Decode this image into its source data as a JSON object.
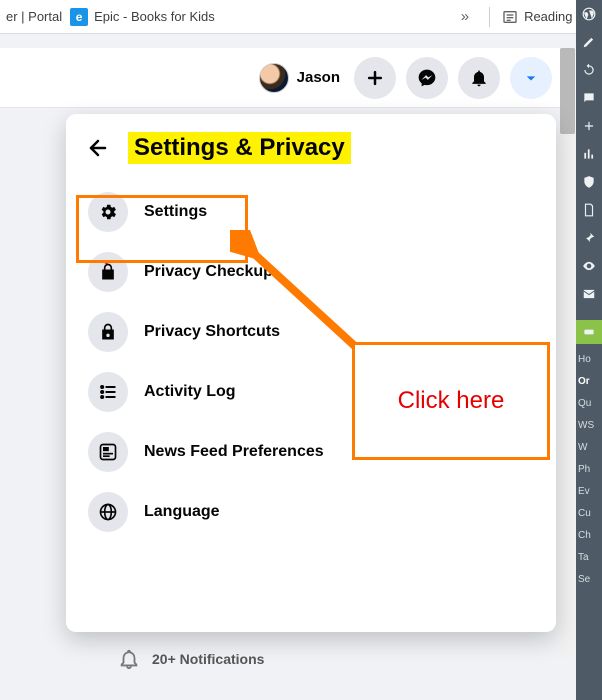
{
  "bookmarks": {
    "link1_text": "er | Portal",
    "link2_text": "Epic - Books for Kids",
    "reading_list_label": "Reading list",
    "overflow_symbol": "»"
  },
  "header": {
    "profile_name": "Jason"
  },
  "panel": {
    "title": "Settings & Privacy",
    "items": [
      {
        "label": "Settings"
      },
      {
        "label": "Privacy Checkup"
      },
      {
        "label": "Privacy Shortcuts"
      },
      {
        "label": "Activity Log"
      },
      {
        "label": "News Feed Preferences"
      },
      {
        "label": "Language"
      }
    ]
  },
  "annotation": {
    "callout_text": "Click here"
  },
  "bottom": {
    "notifications_label": "20+ Notifications"
  },
  "admin_sidebar": {
    "items": [
      "Ho",
      "Or",
      "Qu",
      "WS",
      "W",
      "Ph",
      "Ev",
      "Cu",
      "Ch",
      "Ta",
      "Se"
    ]
  }
}
